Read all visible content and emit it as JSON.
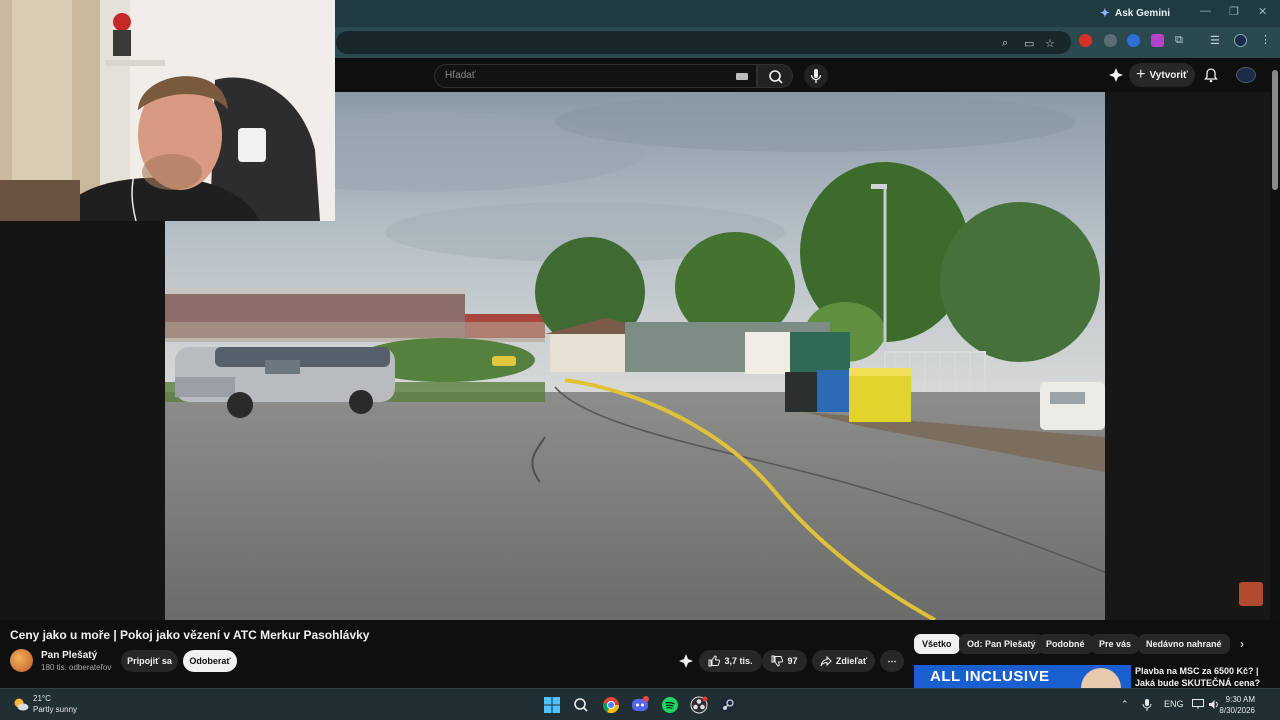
{
  "browser": {
    "ask_gemini": "Ask Gemini"
  },
  "youtube": {
    "search_placeholder": "Hľadať",
    "create_label": "Vytvoriť"
  },
  "video": {
    "title": "Ceny jako u moře | Pokoj jako vězení v ATC Merkur Pasohlávky",
    "channel_name": "Pan Plešatý",
    "channel_subs": "180 tis. odberateľov",
    "join_label": "Pripojiť sa",
    "unsubscribe_label": "Odoberať",
    "likes": "3,7 tis.",
    "dislikes": "97",
    "share_label": "Zdieľať"
  },
  "chips": [
    "Všetko",
    "Od: Pan Plešatý",
    "Podobné",
    "Pre vás",
    "Nedávno nahrané"
  ],
  "recommendation": {
    "thumb_text": "ALL INCLUSIVE",
    "title": "Plavba na MSC za 6500 Kč? | Jaká bude SKUTEČNÁ cena? |"
  },
  "taskbar": {
    "temperature": "21°C",
    "condition": "Partly sunny",
    "language": "ENG",
    "time": "9:30 AM",
    "date": "8/30/2026"
  },
  "colors": {
    "titlebar": "#1f3a40",
    "toolbar": "#2b4a50",
    "youtube_bg": "#0f0f0f",
    "taskbar": "#1f2f33"
  }
}
